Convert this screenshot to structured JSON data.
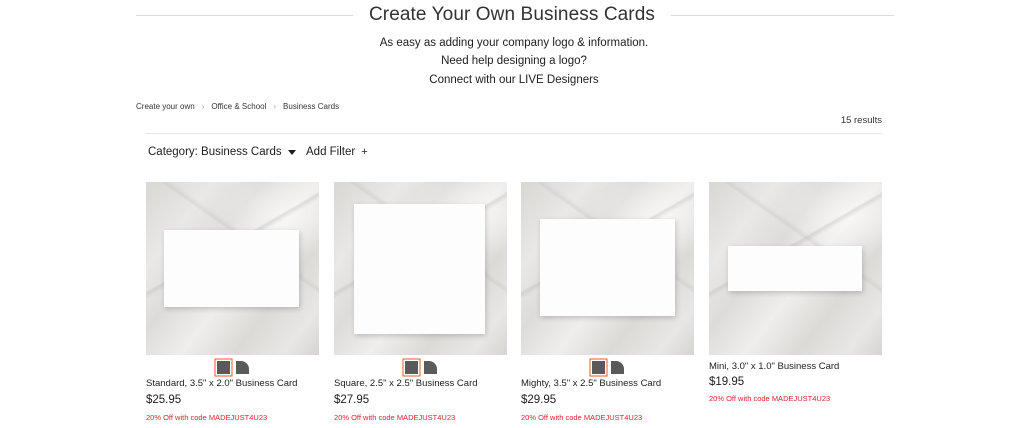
{
  "header": {
    "title": "Create Your Own Business Cards",
    "intro_lines": [
      "As easy as adding your company logo & information.",
      "Need help designing a logo?",
      "Connect with our LIVE Designers"
    ]
  },
  "breadcrumb": [
    "Create your own",
    "Office & School",
    "Business Cards"
  ],
  "results_text": "15 results",
  "filters": {
    "category_label": "Category: Business Cards",
    "add_filter_label": "Add Filter",
    "add_filter_symbol": "+"
  },
  "colors": {
    "promo": "#d8262d",
    "swatch_selected_ring": "#d9622b",
    "swatch": "#5a5a5a"
  },
  "products": [
    {
      "title": "Standard, 3.5\" x 2.0\" Business Card",
      "price": "$25.95",
      "promo": "20% Off with code MADEJUST4U23"
    },
    {
      "title": "Square, 2.5\" x 2.5\" Business Card",
      "price": "$27.95",
      "promo": "20% Off with code MADEJUST4U23"
    },
    {
      "title": "Mighty, 3.5\" x 2.5\" Business Card",
      "price": "$29.95",
      "promo": "20% Off with code MADEJUST4U23"
    },
    {
      "title": "Mini, 3.0\" x 1.0\" Business Card",
      "price": "$19.95",
      "promo": "20% Off with code MADEJUST4U23"
    }
  ]
}
